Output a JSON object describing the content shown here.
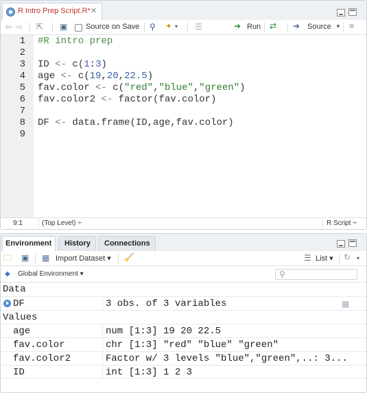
{
  "editor": {
    "tab_title": "R Intro Prep Script.R*",
    "toolbar": {
      "source_on_save_label": "Source on Save",
      "run_label": "Run",
      "source_label": "Source"
    },
    "line_numbers": [
      "1",
      "2",
      "3",
      "4",
      "5",
      "6",
      "7",
      "8",
      "9"
    ],
    "lines": [
      [
        {
          "t": "#R intro prep",
          "k": "comment"
        }
      ],
      [],
      [
        {
          "t": "ID ",
          "k": "plain"
        },
        {
          "t": "<-",
          "k": "op"
        },
        {
          "t": " c(",
          "k": "plain"
        },
        {
          "t": "1",
          "k": "num"
        },
        {
          "t": ":",
          "k": "plain"
        },
        {
          "t": "3",
          "k": "num"
        },
        {
          "t": ")",
          "k": "plain"
        }
      ],
      [
        {
          "t": "age ",
          "k": "plain"
        },
        {
          "t": "<-",
          "k": "op"
        },
        {
          "t": " c(",
          "k": "plain"
        },
        {
          "t": "19",
          "k": "num"
        },
        {
          "t": ",",
          "k": "plain"
        },
        {
          "t": "20",
          "k": "num"
        },
        {
          "t": ",",
          "k": "plain"
        },
        {
          "t": "22.5",
          "k": "num"
        },
        {
          "t": ")",
          "k": "plain"
        }
      ],
      [
        {
          "t": "fav.color ",
          "k": "plain"
        },
        {
          "t": "<-",
          "k": "op"
        },
        {
          "t": " c(",
          "k": "plain"
        },
        {
          "t": "\"red\"",
          "k": "str"
        },
        {
          "t": ",",
          "k": "plain"
        },
        {
          "t": "\"blue\"",
          "k": "str"
        },
        {
          "t": ",",
          "k": "plain"
        },
        {
          "t": "\"green\"",
          "k": "str"
        },
        {
          "t": ")",
          "k": "plain"
        }
      ],
      [
        {
          "t": "fav.color2 ",
          "k": "plain"
        },
        {
          "t": "<-",
          "k": "op"
        },
        {
          "t": " factor(fav.color)",
          "k": "plain"
        }
      ],
      [],
      [
        {
          "t": "DF ",
          "k": "plain"
        },
        {
          "t": "<-",
          "k": "op"
        },
        {
          "t": " data.frame(ID,age,fav.color)",
          "k": "plain"
        }
      ],
      []
    ],
    "status": {
      "cursor": "9:1",
      "scope": "(Top Level) ÷",
      "file_type": "R Script ÷"
    }
  },
  "environment": {
    "tabs": [
      "Environment",
      "History",
      "Connections"
    ],
    "toolbar": {
      "import_label": "Import Dataset ▾",
      "view_label": "List ▾",
      "scope_label": "Global Environment ▾"
    },
    "data_header": "Data",
    "data_rows": [
      {
        "name": "DF",
        "value": "3 obs. of 3 variables"
      }
    ],
    "values_header": "Values",
    "value_rows": [
      {
        "name": "age",
        "value": "num [1:3] 19 20 22.5"
      },
      {
        "name": "fav.color",
        "value": "chr [1:3] \"red\" \"blue\" \"green\""
      },
      {
        "name": "fav.color2",
        "value": "Factor w/ 3 levels \"blue\",\"green\",..: 3..."
      },
      {
        "name": "ID",
        "value": "int [1:3] 1 2 3"
      }
    ]
  },
  "colors": {
    "comment": "#4a8a4a",
    "number": "#3a5fa3",
    "string": "#2f7d2f",
    "tab_title": "#c4352b"
  }
}
